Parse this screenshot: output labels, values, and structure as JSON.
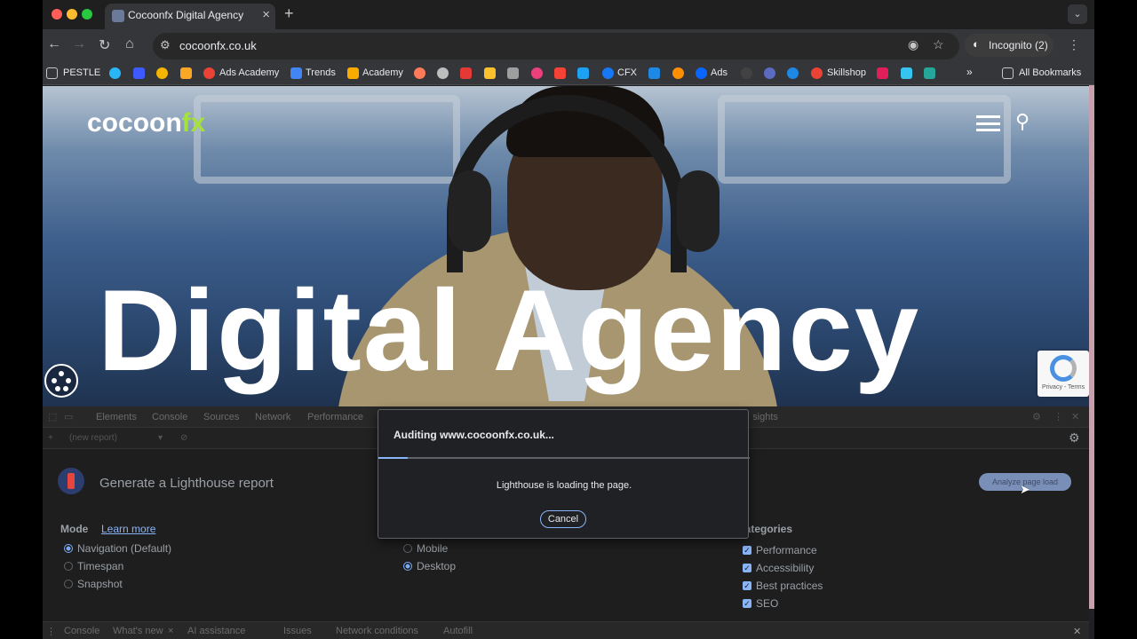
{
  "browser": {
    "tab_title": "Cocoonfx Digital Agency",
    "url": "cocoonfx.co.uk",
    "incognito_label": "Incognito (2)"
  },
  "bookmarks": {
    "items": [
      "PESTLE",
      "Ads Academy",
      "Trends",
      "Academy",
      "CFX",
      "Ads",
      "Skillshop"
    ],
    "all_bookmarks": "All Bookmarks",
    "overflow": "»"
  },
  "hero": {
    "logo_main": "cocoon",
    "logo_accent": "fx",
    "headline": "Digital Agency",
    "recaptcha_text": "Privacy - Terms"
  },
  "devtools": {
    "tabs": [
      "Elements",
      "Console",
      "Sources",
      "Network",
      "Performance",
      "Insights"
    ],
    "report_placeholder": "(new report)",
    "lighthouse_title": "Generate a Lighthouse report",
    "analyze_button": "Analyze page load",
    "mode_label": "Mode",
    "learn_more": "Learn more",
    "modes": [
      {
        "label": "Navigation (Default)",
        "selected": true
      },
      {
        "label": "Timespan",
        "selected": false
      },
      {
        "label": "Snapshot",
        "selected": false
      }
    ],
    "devices": [
      {
        "label": "Mobile",
        "selected": false
      },
      {
        "label": "Desktop",
        "selected": true
      }
    ],
    "categories_label": "Categories",
    "categories": [
      {
        "label": "Performance",
        "checked": true
      },
      {
        "label": "Accessibility",
        "checked": true
      },
      {
        "label": "Best practices",
        "checked": true
      },
      {
        "label": "SEO",
        "checked": true
      }
    ],
    "drawer_tabs": [
      "Console",
      "What's new",
      "AI assistance",
      "Issues",
      "Network conditions",
      "Autofill"
    ]
  },
  "dialog": {
    "title": "Auditing www.cocoonfx.co.uk...",
    "message": "Lighthouse is loading the page.",
    "cancel": "Cancel",
    "progress": 0.08
  },
  "colors": {
    "accent": "#a6e03a",
    "link": "#8ab4f8"
  }
}
